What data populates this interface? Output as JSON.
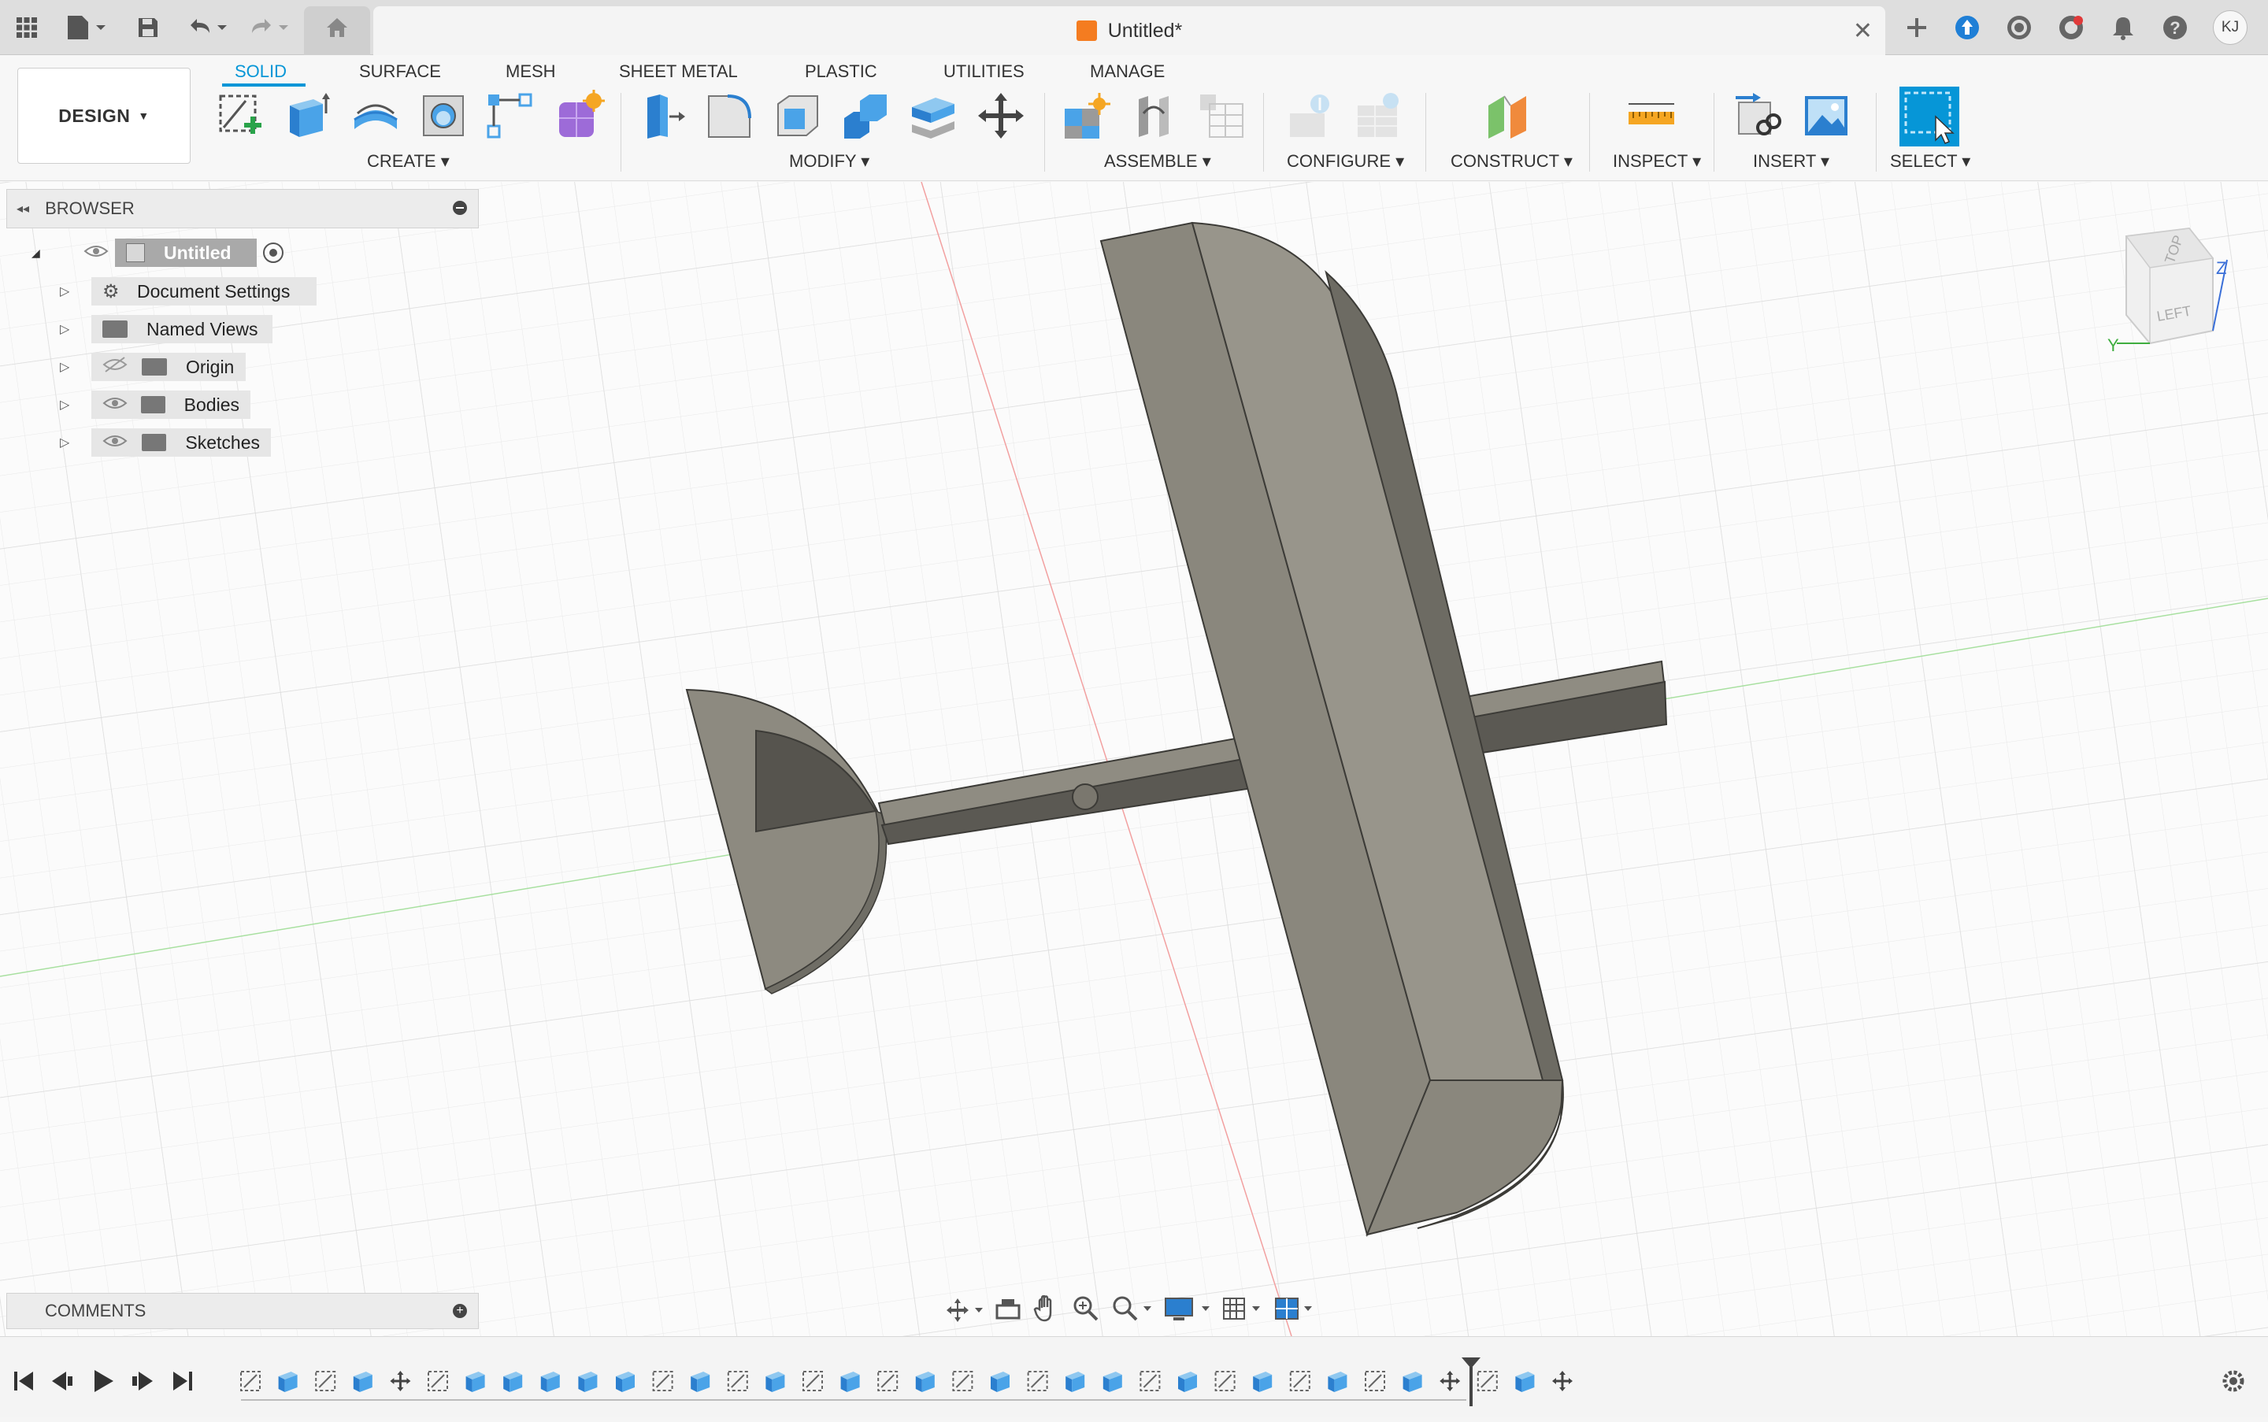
{
  "app": {
    "document_title": "Untitled*",
    "user_initials": "KJ"
  },
  "colors": {
    "accent": "#0696d7",
    "doc_cube": "#f47c20",
    "model": "#8f8c82"
  },
  "toolbar": {
    "workspace_label": "DESIGN",
    "tabs": [
      {
        "label": "SOLID",
        "active": true
      },
      {
        "label": "SURFACE"
      },
      {
        "label": "MESH"
      },
      {
        "label": "SHEET METAL"
      },
      {
        "label": "PLASTIC"
      },
      {
        "label": "UTILITIES"
      },
      {
        "label": "MANAGE"
      }
    ],
    "groups": {
      "create": "CREATE",
      "modify": "MODIFY",
      "assemble": "ASSEMBLE",
      "configure": "CONFIGURE",
      "construct": "CONSTRUCT",
      "inspect": "INSPECT",
      "insert": "INSERT",
      "select": "SELECT"
    }
  },
  "browser": {
    "title": "BROWSER",
    "root": "Untitled",
    "items": [
      {
        "label": "Document Settings",
        "icon": "gear-icon"
      },
      {
        "label": "Named Views",
        "icon": "folder-icon"
      },
      {
        "label": "Origin",
        "icon": "folder-icon",
        "hidden": true
      },
      {
        "label": "Bodies",
        "icon": "folder-icon"
      },
      {
        "label": "Sketches",
        "icon": "folder-icon"
      }
    ]
  },
  "comments": {
    "title": "COMMENTS"
  },
  "viewcube": {
    "top": "TOP",
    "left": "LEFT",
    "axis_z": "Z",
    "axis_y": "Y"
  }
}
